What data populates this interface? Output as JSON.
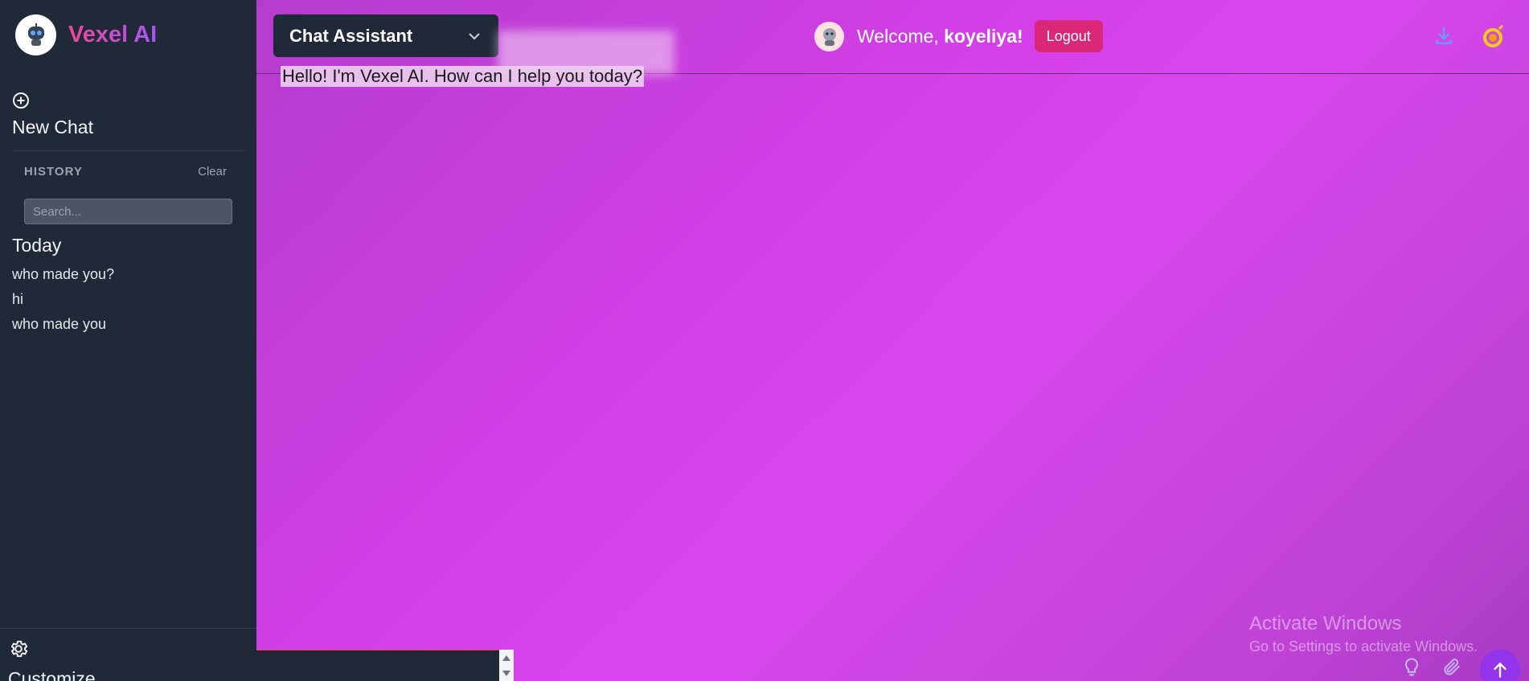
{
  "sidebar": {
    "brand_name": "Vexel AI",
    "logo_icon": "robot-icon",
    "new_chat_label": "New Chat",
    "history_title": "HISTORY",
    "clear_label": "Clear",
    "search_placeholder": "Search...",
    "today_label": "Today",
    "history_items": [
      "who made you?",
      "hi",
      "who made you"
    ],
    "customize_label": "Customize"
  },
  "header": {
    "model_selected": "Chat Assistant",
    "welcome_prefix": "Welcome, ",
    "username": "koyeliya",
    "welcome_suffix": "!",
    "logout_label": "Logout"
  },
  "chat": {
    "greeting": "Hello! I'm Vexel AI. How can I help you today?"
  },
  "watermark": {
    "title": "Activate Windows",
    "subtitle": "Go to Settings to activate Windows."
  },
  "colors": {
    "sidebar_bg": "#1f2937",
    "accent_pink": "#db2777",
    "main_gradient_mid": "#d946ef",
    "send_button": "#9333ea"
  }
}
